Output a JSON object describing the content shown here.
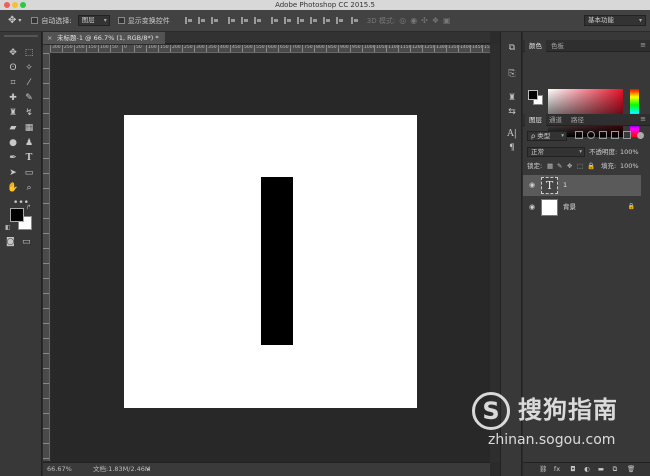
{
  "window": {
    "title": "Adobe Photoshop CC 2015.5"
  },
  "options_bar": {
    "auto_select_label": "自动选择:",
    "auto_select_value": "图层",
    "show_transform_label": "显示变换控件",
    "mode_3d": "3D 模式:",
    "workspace": "基本功能"
  },
  "document": {
    "tab_title": "未标题-1 @ 66.7% (1, RGB/8*) *",
    "close_glyph": "×",
    "background_color": "#ffffff",
    "glyph_color": "#000000"
  },
  "ruler": {
    "h_ticks": [
      "300",
      "250",
      "200",
      "150",
      "100",
      "50",
      "0",
      "50",
      "100",
      "150",
      "200",
      "250",
      "300",
      "350",
      "400",
      "450",
      "500",
      "550",
      "600",
      "650",
      "700",
      "750",
      "800",
      "850",
      "900",
      "950",
      "1000",
      "1050",
      "1100",
      "1150",
      "1200",
      "1250",
      "1300",
      "1350",
      "1400",
      "1450",
      "1500"
    ]
  },
  "status": {
    "zoom": "66.67%",
    "doc_info": "文档:1.83M/2.46M"
  },
  "color_panel": {
    "tab_color": "颜色",
    "tab_swatches": "色板",
    "fg_color": "#000000",
    "bg_color": "#ffffff"
  },
  "layers_panel": {
    "tab_layers": "图层",
    "tab_channels": "通道",
    "tab_paths": "路径",
    "filter_kind": "ρ 类型",
    "blend_mode": "正常",
    "opacity_label": "不透明度:",
    "opacity_value": "100%",
    "lock_label": "锁定:",
    "fill_label": "填充:",
    "fill_value": "100%",
    "layers": [
      {
        "name": "1",
        "type": "text",
        "thumb_glyph": "T",
        "selected": true
      },
      {
        "name": "背景",
        "type": "background",
        "selected": false
      }
    ],
    "bottom_icons": [
      "link-icon",
      "fx-icon",
      "mask-icon",
      "adjustment-icon",
      "folder-icon",
      "new-layer-icon",
      "trash-icon"
    ]
  },
  "watermark": {
    "logo_letter": "S",
    "text_cn": "搜狗指南",
    "url": "zhinan.sogou.com"
  }
}
